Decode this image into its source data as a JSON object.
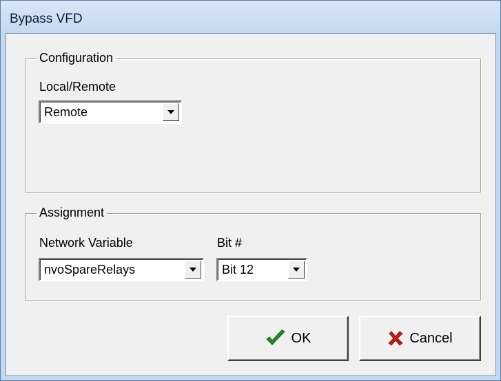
{
  "window": {
    "title": "Bypass VFD"
  },
  "configuration": {
    "group_title": "Configuration",
    "local_remote_label": "Local/Remote",
    "local_remote_value": "Remote"
  },
  "assignment": {
    "group_title": "Assignment",
    "network_variable_label": "Network Variable",
    "network_variable_value": "nvoSpareRelays",
    "bit_label": "Bit #",
    "bit_value": "Bit 12"
  },
  "buttons": {
    "ok_label": "OK",
    "cancel_label": "Cancel"
  },
  "icons": {
    "ok": "checkmark-icon",
    "cancel": "red-x-icon",
    "dropdown": "chevron-down-icon"
  },
  "colors": {
    "titlebar": "#c6d9ee",
    "dialog_bg": "#f0f0f0",
    "ok_icon": "#1f8f1f",
    "cancel_icon": "#c41a0e"
  }
}
